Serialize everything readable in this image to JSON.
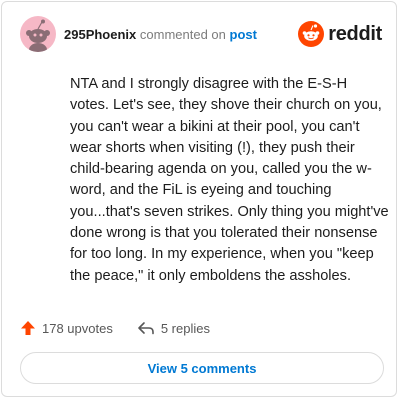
{
  "comment": {
    "username": "295Phoenix",
    "commented_on": "commented on",
    "post_link": "post",
    "body": "NTA and I strongly disagree with the E-S-H votes. Let's see, they shove their church on you, you can't wear a bikini at their pool, you can't wear shorts when visiting (!), they push their child-bearing agenda on you, called you the w-word, and the FiL is eyeing and touching you...that's seven strikes. Only thing you might've done wrong is that you tolerated their nonsense for too long. In my experience, when you \"keep the peace,\" it only emboldens the assholes.",
    "upvotes": "178 upvotes",
    "replies": "5 replies",
    "view_comments": "View 5 comments"
  },
  "brand": {
    "name": "reddit",
    "color": "#ff4500"
  },
  "icons": {
    "avatar": "snoo-avatar-icon",
    "logo": "reddit-logo-icon",
    "upvote": "upvote-arrow-icon",
    "reply": "reply-arrow-icon"
  },
  "colors": {
    "link": "#0079d3",
    "avatar_bg": "#f6b8c6",
    "upvote": "#ff4500"
  }
}
